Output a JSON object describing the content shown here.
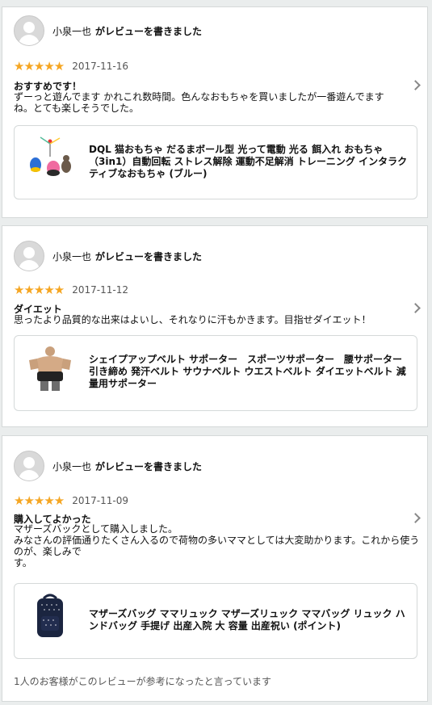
{
  "reviews": [
    {
      "author": "小泉一也",
      "action": "がレビューを書きました",
      "stars": "★★★★★",
      "date": "2017-11-16",
      "title": "おすすめです！",
      "body": "ずーっと遊んでます かれこれ数時間。色んなおもちゃを買いましたが一番遊んでます\nね。とても楽しそうでした。",
      "product_name": "DQL 猫おもちゃ だるまボール型 光って電動 光る 餌入れ おもちゃ（3in1）自動回転 ストレス解除 運動不足解消 トレーニング インタラクティブなおもちゃ (ブルー)",
      "product_icon": "cat-toy-image"
    },
    {
      "author": "小泉一也",
      "action": "がレビューを書きました",
      "stars": "★★★★★",
      "date": "2017-11-12",
      "title": "ダイエット",
      "body": "思ったより品質的な出来はよいし、それなりに汗もかきます。目指せダイエット！",
      "product_name": "シェイプアップベルト サポーター　スポーツサポーター　腰サポーター　引き締め 発汗ベルト サウナベルト ウエストベルト ダイエットベルト 減量用サポーター",
      "product_icon": "waist-belt-image"
    },
    {
      "author": "小泉一也",
      "action": "がレビューを書きました",
      "stars": "★★★★★",
      "date": "2017-11-09",
      "title": "購入してよかった",
      "body": "マザーズバックとして購入しました。\nみなさんの評価通りたくさん入るので荷物の多いママとしては大変助かります。これから使うのが、楽しみで\nす。",
      "product_name": "マザーズバッグ ママリュック マザーズリュック ママバッグ リュック ハンドバッグ 手提げ 出産入院 大 容量 出産祝い (ポイント)",
      "product_icon": "backpack-image",
      "helpful": "1人のお客様がこのレビューが参考になったと言っています"
    }
  ],
  "colors": {
    "star": "#f5a623",
    "border": "#d5d9d9",
    "background": "#eaeded"
  }
}
